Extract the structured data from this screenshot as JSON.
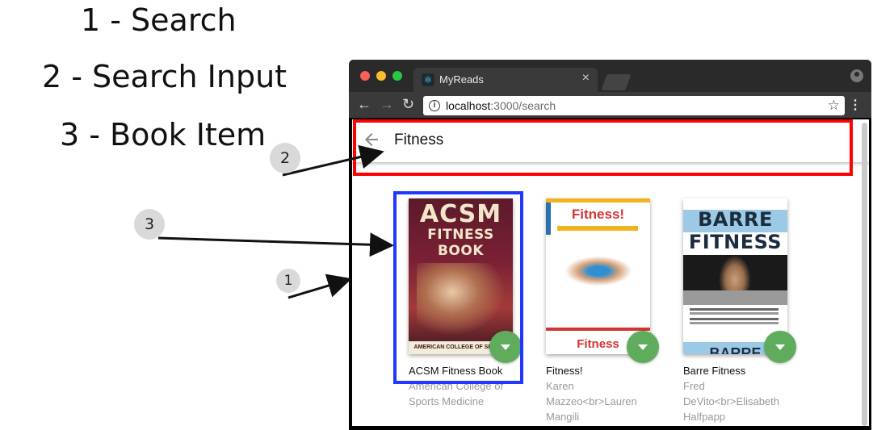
{
  "legend": {
    "item1": "1 - Search",
    "item2": "2 - Search Input",
    "item3": "3 - Book Item"
  },
  "callouts": {
    "one": "1",
    "two": "2",
    "three": "3"
  },
  "browser": {
    "tab_title": "MyReads",
    "tab_close": "×",
    "url_host": "localhost",
    "url_path": ":3000/search",
    "nav_back": "←",
    "nav_forward": "→",
    "nav_reload": "↻",
    "star": "☆",
    "menu": "⋮",
    "info": "i",
    "favicon": "⚛"
  },
  "search": {
    "value": "Fitness",
    "back_icon": "arrow-back-icon"
  },
  "books": [
    {
      "title": "ACSM Fitness Book",
      "authors": "American College of Sports Medicine",
      "cover_title": "ACSM",
      "cover_subtitle": "FITNESS BOOK",
      "cover_footer": "AMERICAN COLLEGE OF SPORTS MEDICINE"
    },
    {
      "title": "Fitness!",
      "authors": "Karen Mazzeo<br>Lauren Mangili",
      "cover_title": "Fitness!",
      "cover_bottom": "Fitness"
    },
    {
      "title": "Barre Fitness",
      "authors": "Fred DeVito<br>Elisabeth Halfpapp",
      "cover_title": "BARRE FITNESS",
      "cover_bottom": "BARRE"
    }
  ],
  "colors": {
    "highlight_search": "#ff0000",
    "highlight_book": "#1f37ff",
    "shelf_button": "#60ac5d"
  }
}
